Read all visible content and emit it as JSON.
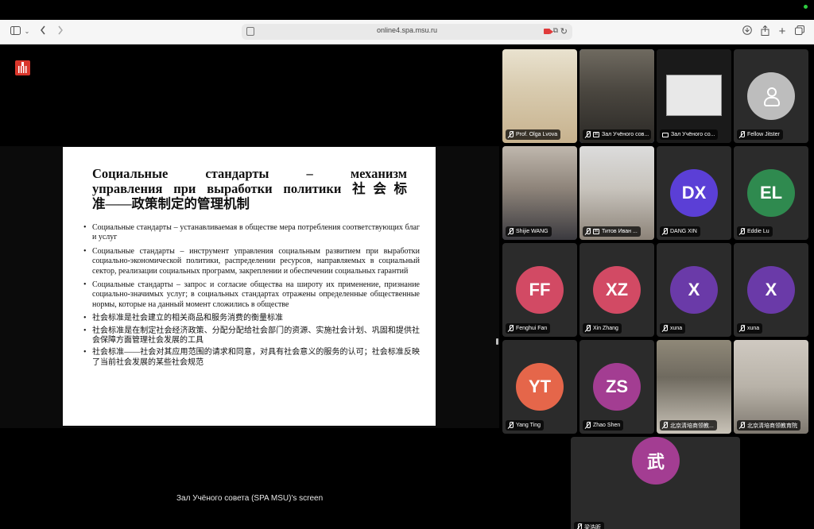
{
  "browser": {
    "url": "online4.spa.msu.ru"
  },
  "slide": {
    "title_line1": "Социальные стандарты – механизм",
    "title_line2": "управления при выработки политики 社会标",
    "title_line3": "准——政策制定的管理机制",
    "bullets": [
      "Социальные стандарты – устанавливаемая в обществе мера потребления соответствующих благ и услуг",
      "Социальные стандарты – инструмент управления социальным развитием при выработки социально-экономической политики, распределении ресурсов, направляемых в социальный сектор, реализации социальных программ, закреплении и обеспечении социальных гарантий",
      "Социальные стандарты – запрос и согласие общества на широту их применение, признание социально-значимых услуг; в социальных стандартах отражены определенные общественные нормы, которые на данный момент сложились в обществе",
      "社会标准是社会建立的相关商品和服务消费的衡量标准",
      "社会标准是在制定社会经济政策、分配分配给社会部门的资源、实施社会计划、巩固和提供社会保障方面管理社会发展的工具",
      "社会标准——社会对其应用范围的请求和同意，对具有社会意义的服务的认可；社会标准反映了当前社会发展的某些社会规范"
    ]
  },
  "share_caption": "Зал Учёного совета (SPA MSU)'s screen",
  "participants": [
    {
      "name": "Prof. Olga Lvova",
      "initials": "",
      "color": "",
      "kind": "video"
    },
    {
      "name": "Зал Учёного сов...",
      "initials": "",
      "color": "",
      "kind": "video"
    },
    {
      "name": "Зал Учёного со...",
      "initials": "",
      "color": "",
      "kind": "screen"
    },
    {
      "name": "Fellow Jitster",
      "initials": "",
      "color": "#bdbdbd",
      "kind": "placeholder"
    },
    {
      "name": "Shijie WANG",
      "initials": "",
      "color": "",
      "kind": "video"
    },
    {
      "name": "Титов Иван ...",
      "initials": "",
      "color": "",
      "kind": "video"
    },
    {
      "name": "DANG XIN",
      "initials": "DX",
      "color": "#5b3fd6",
      "kind": "avatar"
    },
    {
      "name": "Eddie Lu",
      "initials": "EL",
      "color": "#2f8a4f",
      "kind": "avatar"
    },
    {
      "name": "Fenghui Fan",
      "initials": "FF",
      "color": "#d24a64",
      "kind": "avatar"
    },
    {
      "name": "Xin Zhang",
      "initials": "XZ",
      "color": "#d24a64",
      "kind": "avatar"
    },
    {
      "name": "xuna",
      "initials": "X",
      "color": "#6a3aa8",
      "kind": "avatar"
    },
    {
      "name": "xuna",
      "initials": "X",
      "color": "#6a3aa8",
      "kind": "avatar"
    },
    {
      "name": "Yang Ting",
      "initials": "YT",
      "color": "#e5664a",
      "kind": "avatar"
    },
    {
      "name": "Zhao Shen",
      "initials": "ZS",
      "color": "#a33d92",
      "kind": "avatar"
    },
    {
      "name": "北京清培商领教...",
      "initials": "",
      "color": "",
      "kind": "video"
    },
    {
      "name": "北京清培商领教育院",
      "initials": "",
      "color": "",
      "kind": "video"
    },
    {
      "name": "梁浩昕",
      "initials": "武",
      "color": "#a33d92",
      "kind": "avatar"
    }
  ]
}
